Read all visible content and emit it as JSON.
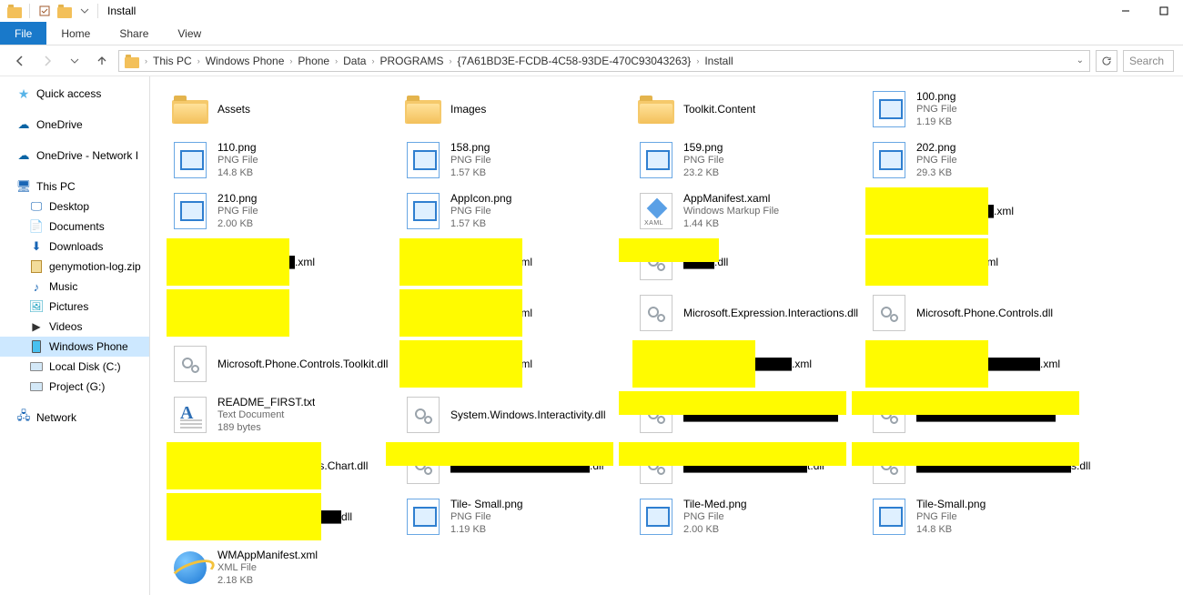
{
  "window": {
    "title": "Install"
  },
  "ribbon": {
    "file": "File",
    "home": "Home",
    "share": "Share",
    "view": "View"
  },
  "breadcrumb": [
    "This PC",
    "Windows Phone",
    "Phone",
    "Data",
    "PROGRAMS",
    "{7A61BD3E-FCDB-4C58-93DE-470C93043263}",
    "Install"
  ],
  "search_placeholder": "Search",
  "nav": {
    "quick": "Quick access",
    "onedrive": "OneDrive",
    "onedrive2": "OneDrive - Network I",
    "thispc": "This PC",
    "desktop": "Desktop",
    "documents": "Documents",
    "downloads": "Downloads",
    "geny": "genymotion-log.zip",
    "music": "Music",
    "pictures": "Pictures",
    "videos": "Videos",
    "winphone": "Windows Phone",
    "diskc": "Local Disk (C:)",
    "diskg": "Project (G:)",
    "network": "Network"
  },
  "files": [
    {
      "name": "Assets",
      "type": "",
      "size": "",
      "icon": "folder",
      "redact": null
    },
    {
      "name": "Images",
      "type": "",
      "size": "",
      "icon": "folder",
      "redact": null
    },
    {
      "name": "Toolkit.Content",
      "type": "",
      "size": "",
      "icon": "folder",
      "redact": null
    },
    {
      "name": "100.png",
      "type": "PNG File",
      "size": "1.19 KB",
      "icon": "png",
      "redact": null
    },
    {
      "name": "110.png",
      "type": "PNG File",
      "size": "14.8 KB",
      "icon": "png",
      "redact": null
    },
    {
      "name": "158.png",
      "type": "PNG File",
      "size": "1.57 KB",
      "icon": "png",
      "redact": null
    },
    {
      "name": "159.png",
      "type": "PNG File",
      "size": "23.2 KB",
      "icon": "png",
      "redact": null
    },
    {
      "name": "202.png",
      "type": "PNG File",
      "size": "29.3 KB",
      "icon": "png",
      "redact": null
    },
    {
      "name": "210.png",
      "type": "PNG File",
      "size": "2.00 KB",
      "icon": "png",
      "redact": null
    },
    {
      "name": "AppIcon.png",
      "type": "PNG File",
      "size": "1.57 KB",
      "icon": "png",
      "redact": null
    },
    {
      "name": "AppManifest.xaml",
      "type": "Windows Markup File",
      "size": "1.44 KB",
      "icon": "xaml",
      "redact": null
    },
    {
      "name": "██████████.xml",
      "type": "",
      "size": "",
      "icon": "ie",
      "redact": "full"
    },
    {
      "name": "██████████.xml",
      "type": "",
      "size": "",
      "icon": "ie",
      "redact": "full"
    },
    {
      "name": "████████.xml",
      "type": "",
      "size": "",
      "icon": "ie",
      "redact": "full"
    },
    {
      "name": "████.dll",
      "type": "",
      "size": "",
      "icon": "dll",
      "redact": "left"
    },
    {
      "name": "████████.xml",
      "type": "",
      "size": "",
      "icon": "ie",
      "redact": "full"
    },
    {
      "name": "████████",
      "type": "",
      "size": "",
      "icon": "ie",
      "redact": "full"
    },
    {
      "name": "████████.xml",
      "type": "",
      "size": "",
      "icon": "ie",
      "redact": "full"
    },
    {
      "name": "Microsoft.Expression.Interactions.dll",
      "type": "",
      "size": "",
      "icon": "dll",
      "redact": null
    },
    {
      "name": "Microsoft.Phone.Controls.dll",
      "type": "",
      "size": "",
      "icon": "dll",
      "redact": null
    },
    {
      "name": "Microsoft.Phone.Controls.Toolkit.dll",
      "type": "",
      "size": "",
      "icon": "dll",
      "redact": null
    },
    {
      "name": "████████.xml",
      "type": "",
      "size": "",
      "icon": "ie",
      "redact": "full"
    },
    {
      "name": "██████████████.xml",
      "type": "",
      "size": "",
      "icon": "ie",
      "redact": "full"
    },
    {
      "name": "████████████████.xml",
      "type": "",
      "size": "",
      "icon": "ie",
      "redact": "full"
    },
    {
      "name": "README_FIRST.txt",
      "type": "Text Document",
      "size": "189 bytes",
      "icon": "txt",
      "redact": null
    },
    {
      "name": "System.Windows.Interactivity.dll",
      "type": "",
      "size": "",
      "icon": "dll",
      "redact": null
    },
    {
      "name": "████████████████████",
      "type": "",
      "size": "",
      "icon": "dll",
      "redact": "wide"
    },
    {
      "name": "██████████████████",
      "type": "",
      "size": "",
      "icon": "dll",
      "redact": "wide"
    },
    {
      "name": "████████████ols.Chart.dll",
      "type": "",
      "size": "",
      "icon": "dll",
      "redact": "left-wide"
    },
    {
      "name": "██████████████████.dll",
      "type": "",
      "size": "",
      "icon": "dll",
      "redact": "wide"
    },
    {
      "name": "████████████████t.dll",
      "type": "",
      "size": "",
      "icon": "dll",
      "redact": "wide"
    },
    {
      "name": "████████████████████s.dll",
      "type": "",
      "size": "",
      "icon": "dll",
      "redact": "wide"
    },
    {
      "name": "████████████████dll",
      "type": "",
      "size": "",
      "icon": "dll",
      "redact": "left-wide"
    },
    {
      "name": "Tile- Small.png",
      "type": "PNG File",
      "size": "1.19 KB",
      "icon": "png",
      "redact": null
    },
    {
      "name": "Tile-Med.png",
      "type": "PNG File",
      "size": "2.00 KB",
      "icon": "png",
      "redact": null
    },
    {
      "name": "Tile-Small.png",
      "type": "PNG File",
      "size": "14.8 KB",
      "icon": "png",
      "redact": null
    },
    {
      "name": "WMAppManifest.xml",
      "type": "XML File",
      "size": "2.18 KB",
      "icon": "ie",
      "redact": null
    }
  ]
}
